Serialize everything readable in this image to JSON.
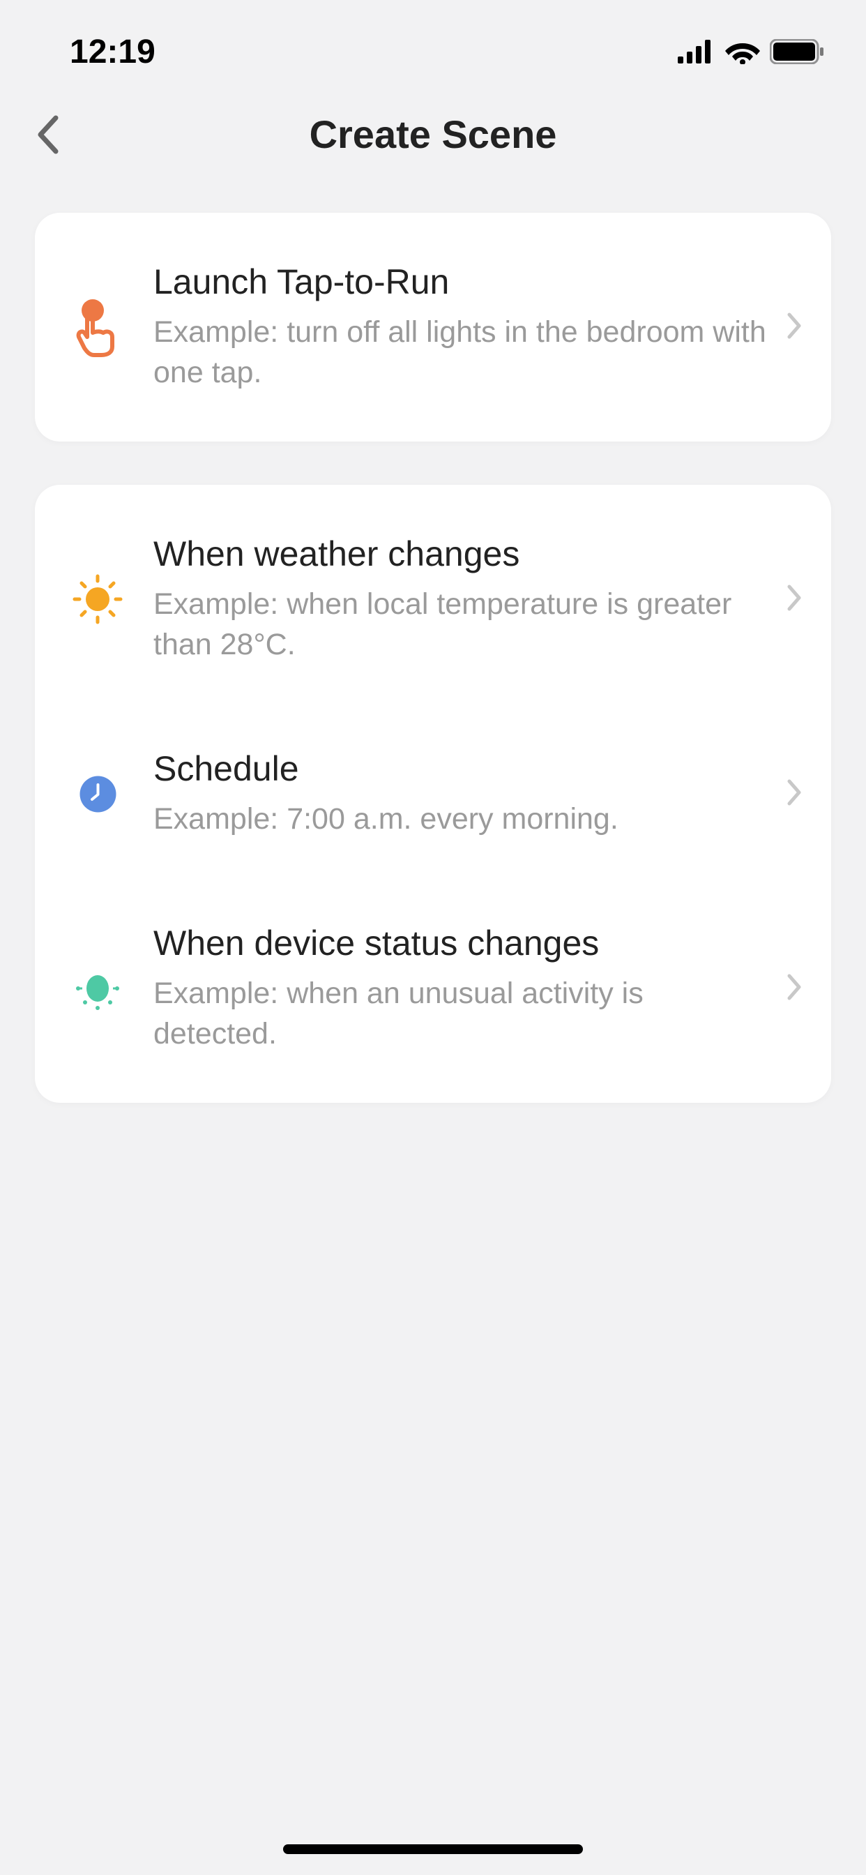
{
  "statusBar": {
    "time": "12:19"
  },
  "navbar": {
    "title": "Create Scene"
  },
  "sections": [
    {
      "items": [
        {
          "icon": "tap-icon",
          "title": "Launch Tap-to-Run",
          "subtitle": "Example: turn off all lights in the bedroom with one tap."
        }
      ]
    },
    {
      "items": [
        {
          "icon": "sun-icon",
          "title": "When weather changes",
          "subtitle": "Example: when local temperature is greater than 28°C."
        },
        {
          "icon": "clock-icon",
          "title": "Schedule",
          "subtitle": "Example: 7:00 a.m. every morning."
        },
        {
          "icon": "bulb-icon",
          "title": "When device status changes",
          "subtitle": "Example: when an unusual activity is detected."
        }
      ]
    }
  ]
}
